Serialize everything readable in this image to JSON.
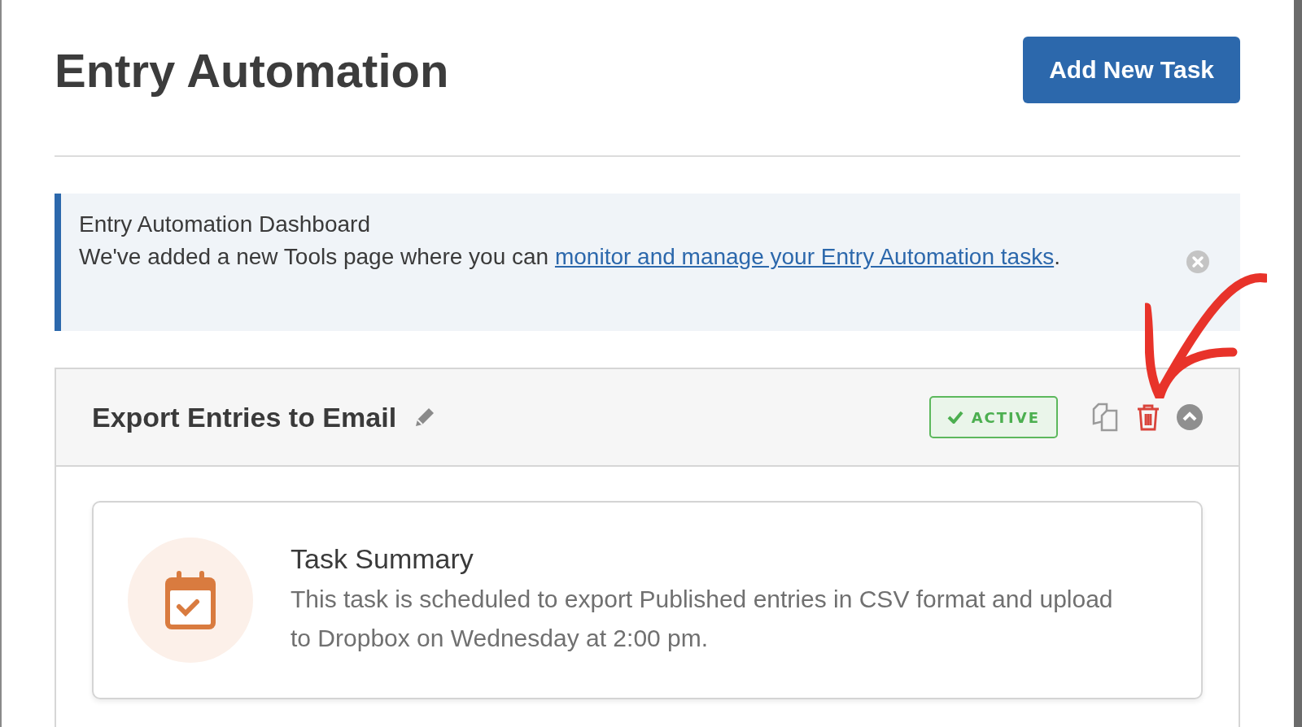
{
  "page": {
    "title": "Entry Automation",
    "add_button": "Add New Task"
  },
  "notice": {
    "title": "Entry Automation Dashboard",
    "text_before": "We've added a new Tools page where you can ",
    "link": "monitor and manage your Entry Automation tasks",
    "text_after": "."
  },
  "task": {
    "name": "Export Entries to Email",
    "status": {
      "label": "ACTIVE",
      "active": true
    },
    "expanded": true,
    "summary": {
      "title": "Task Summary",
      "text": "This task is scheduled to export Published entries in CSV format and upload to Dropbox on Wednesday at 2:00 pm."
    }
  }
}
